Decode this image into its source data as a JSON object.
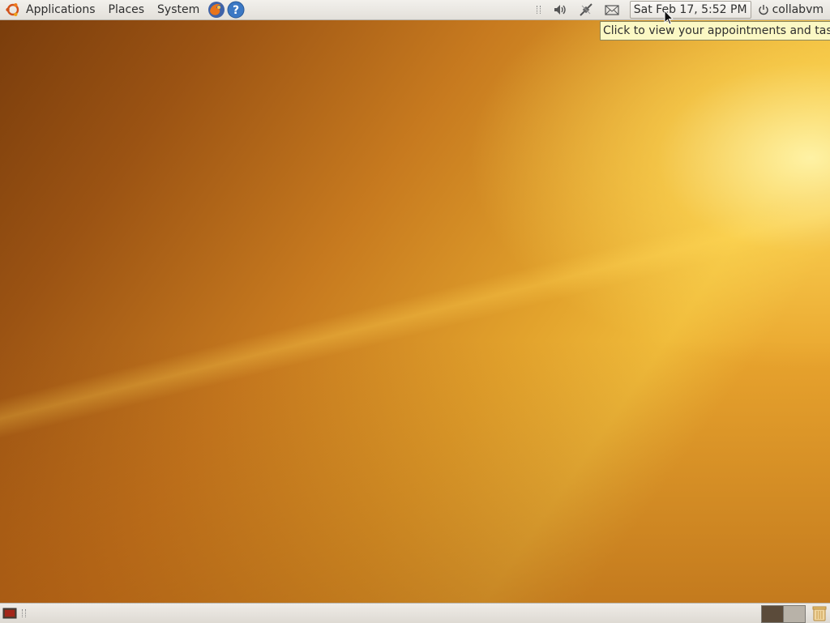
{
  "top_panel": {
    "menus": {
      "applications": "Applications",
      "places": "Places",
      "system": "System"
    },
    "launchers": [
      "firefox-icon",
      "help-icon"
    ],
    "tray_icons": [
      "volume-icon",
      "network-icon",
      "mail-icon"
    ],
    "clock": "Sat Feb 17,  5:52 PM",
    "user": "collabvm"
  },
  "tooltip": "Click to view your appointments and tasks",
  "bottom_panel": {
    "items": [
      "show-desktop-icon",
      "workspace-1",
      "workspace-2",
      "trash-icon"
    ]
  },
  "colors": {
    "panel": "#e9e6e0",
    "tooltip": "#fbf8c4",
    "wallpaper_accent": "#e2a22c"
  }
}
